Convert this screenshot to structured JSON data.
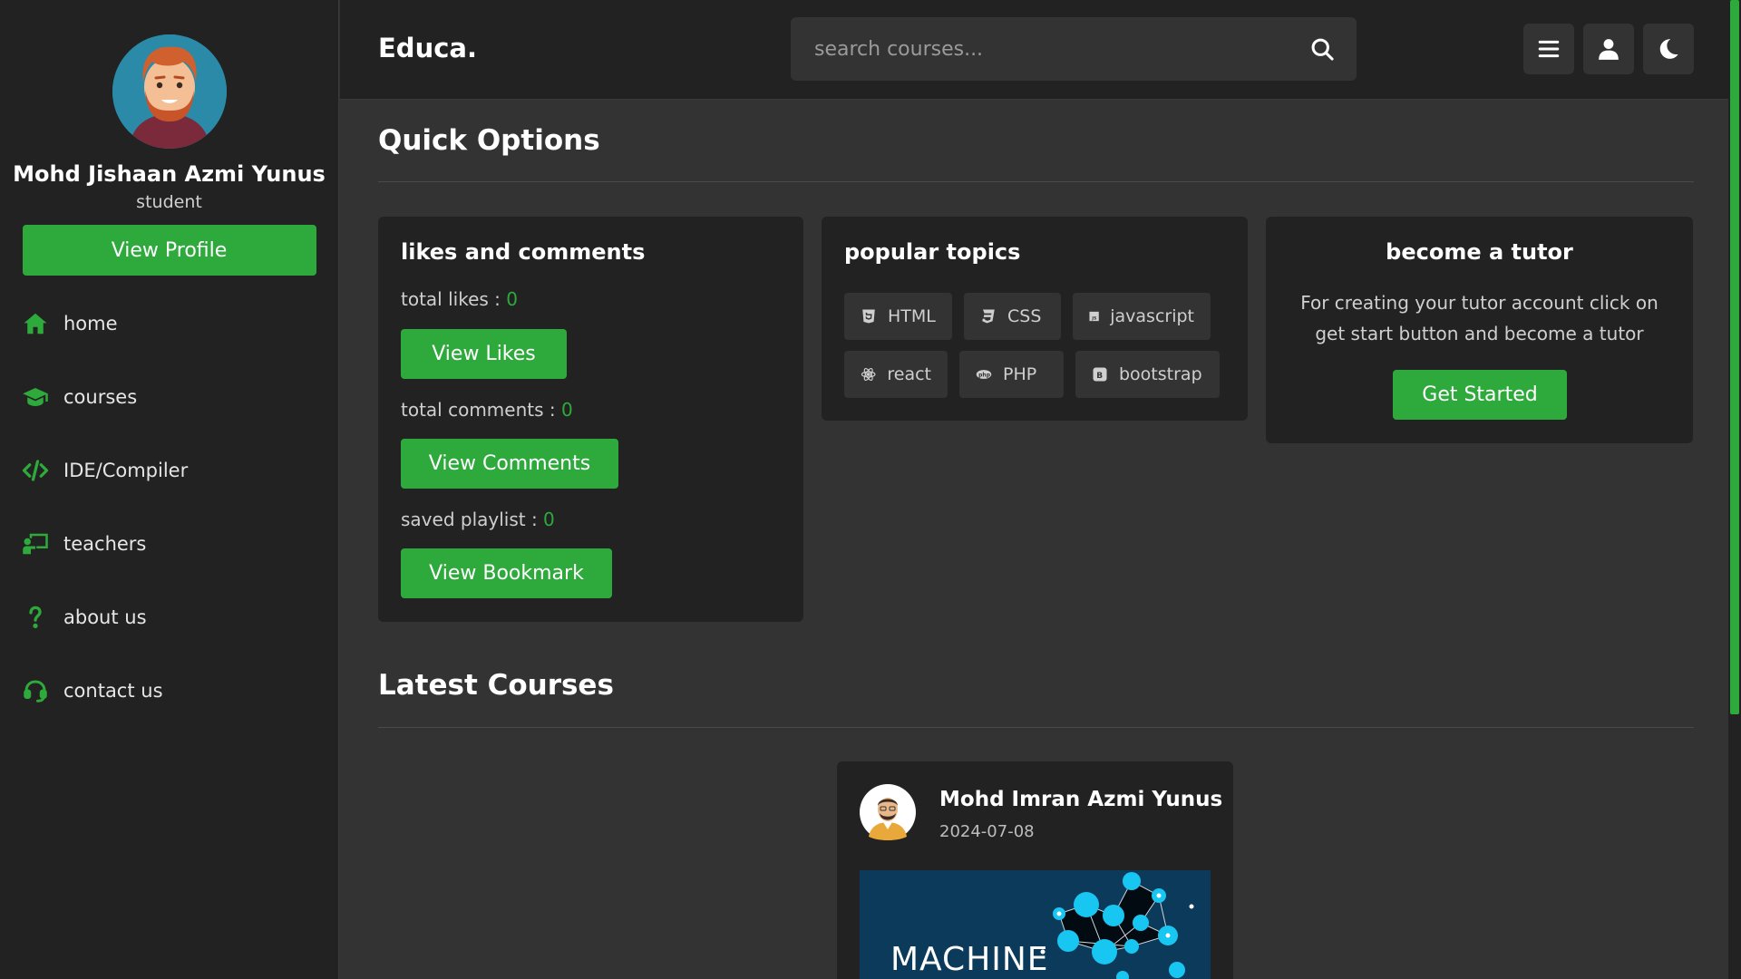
{
  "sidebar": {
    "profile": {
      "name": "Mohd Jishaan Azmi Yunus",
      "role": "student",
      "view_profile_label": "View Profile"
    },
    "items": [
      {
        "label": "home",
        "icon": "home-icon"
      },
      {
        "label": "courses",
        "icon": "graduation-cap-icon"
      },
      {
        "label": "IDE/Compiler",
        "icon": "code-icon"
      },
      {
        "label": "teachers",
        "icon": "chalkboard-teacher-icon"
      },
      {
        "label": "about us",
        "icon": "question-icon"
      },
      {
        "label": "contact us",
        "icon": "headset-icon"
      }
    ]
  },
  "header": {
    "logo": "Educa.",
    "search_placeholder": "search courses..."
  },
  "quick_options": {
    "title": "Quick Options",
    "likes_card": {
      "title": "likes and comments",
      "total_likes_label": "total likes : ",
      "total_likes": "0",
      "view_likes_label": "View Likes",
      "total_comments_label": "total comments : ",
      "total_comments": "0",
      "view_comments_label": "View Comments",
      "saved_playlist_label": "saved playlist : ",
      "saved_playlist": "0",
      "view_bookmark_label": "View Bookmark"
    },
    "topics_card": {
      "title": "popular topics",
      "tags": [
        {
          "label": "HTML",
          "icon": "html5-icon"
        },
        {
          "label": "CSS",
          "icon": "css3-icon"
        },
        {
          "label": "javascript",
          "icon": "js-icon"
        },
        {
          "label": "react",
          "icon": "react-icon"
        },
        {
          "label": "PHP",
          "icon": "php-icon"
        },
        {
          "label": "bootstrap",
          "icon": "bootstrap-icon"
        }
      ]
    },
    "tutor_card": {
      "title": "become a tutor",
      "text": "For creating your tutor account click on get start button and become a tutor",
      "button_label": "Get Started"
    }
  },
  "latest_courses": {
    "title": "Latest Courses",
    "course": {
      "tutor_name": "Mohd Imran Azmi Yunus",
      "date": "2024-07-08",
      "thumbnail_text": "MACHINE"
    }
  },
  "colors": {
    "accent": "#2eaa3c",
    "panel": "#222222",
    "background": "#333333"
  }
}
